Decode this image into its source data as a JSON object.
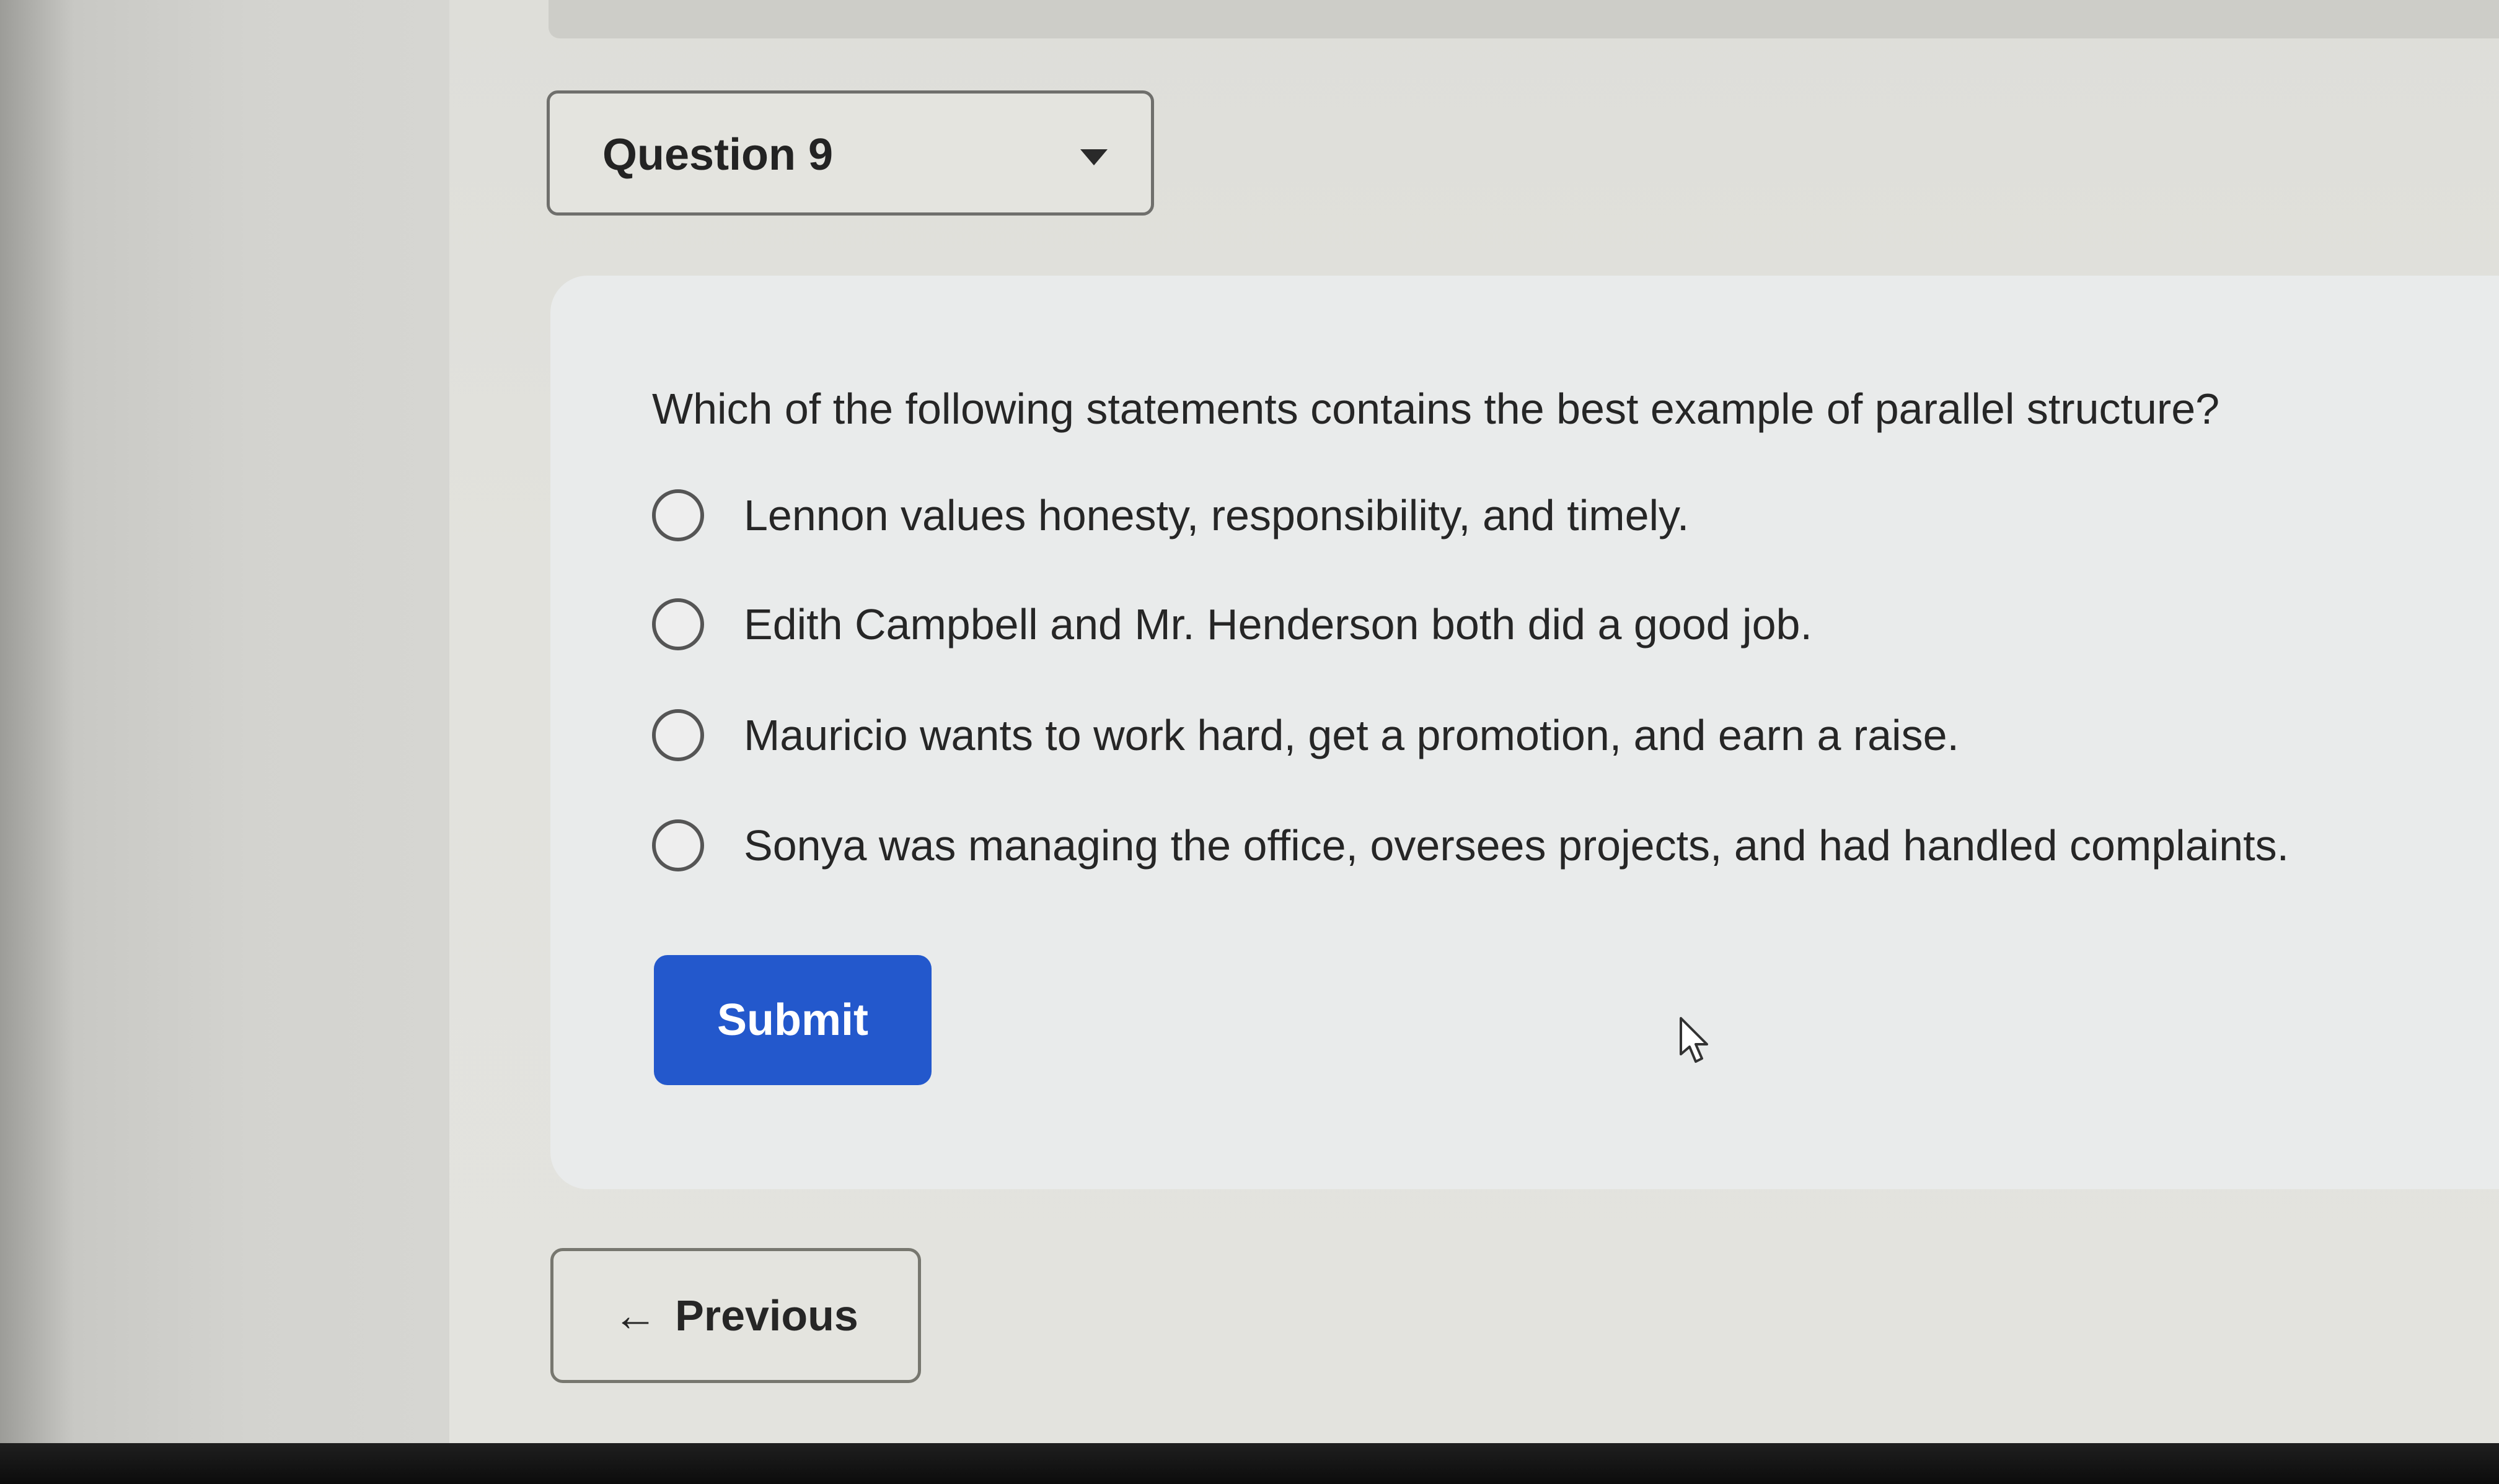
{
  "question_selector": {
    "label": "Question 9"
  },
  "question": {
    "prompt": "Which of the following statements contains the best example of parallel structure?",
    "options": [
      {
        "label": "Lennon values honesty, responsibility, and timely."
      },
      {
        "label": "Edith Campbell and Mr. Henderson both did a good job."
      },
      {
        "label": "Mauricio wants to work hard, get a promotion, and earn a raise."
      },
      {
        "label": "Sonya was managing the office, oversees projects, and had handled complaints."
      }
    ],
    "selected_index": null
  },
  "actions": {
    "submit_label": "Submit",
    "previous_label": "Previous",
    "previous_icon": "arrow-left-icon"
  },
  "colors": {
    "primary_button": "#2358cc",
    "text": "#262626",
    "card_background": "#e9ebeb"
  }
}
